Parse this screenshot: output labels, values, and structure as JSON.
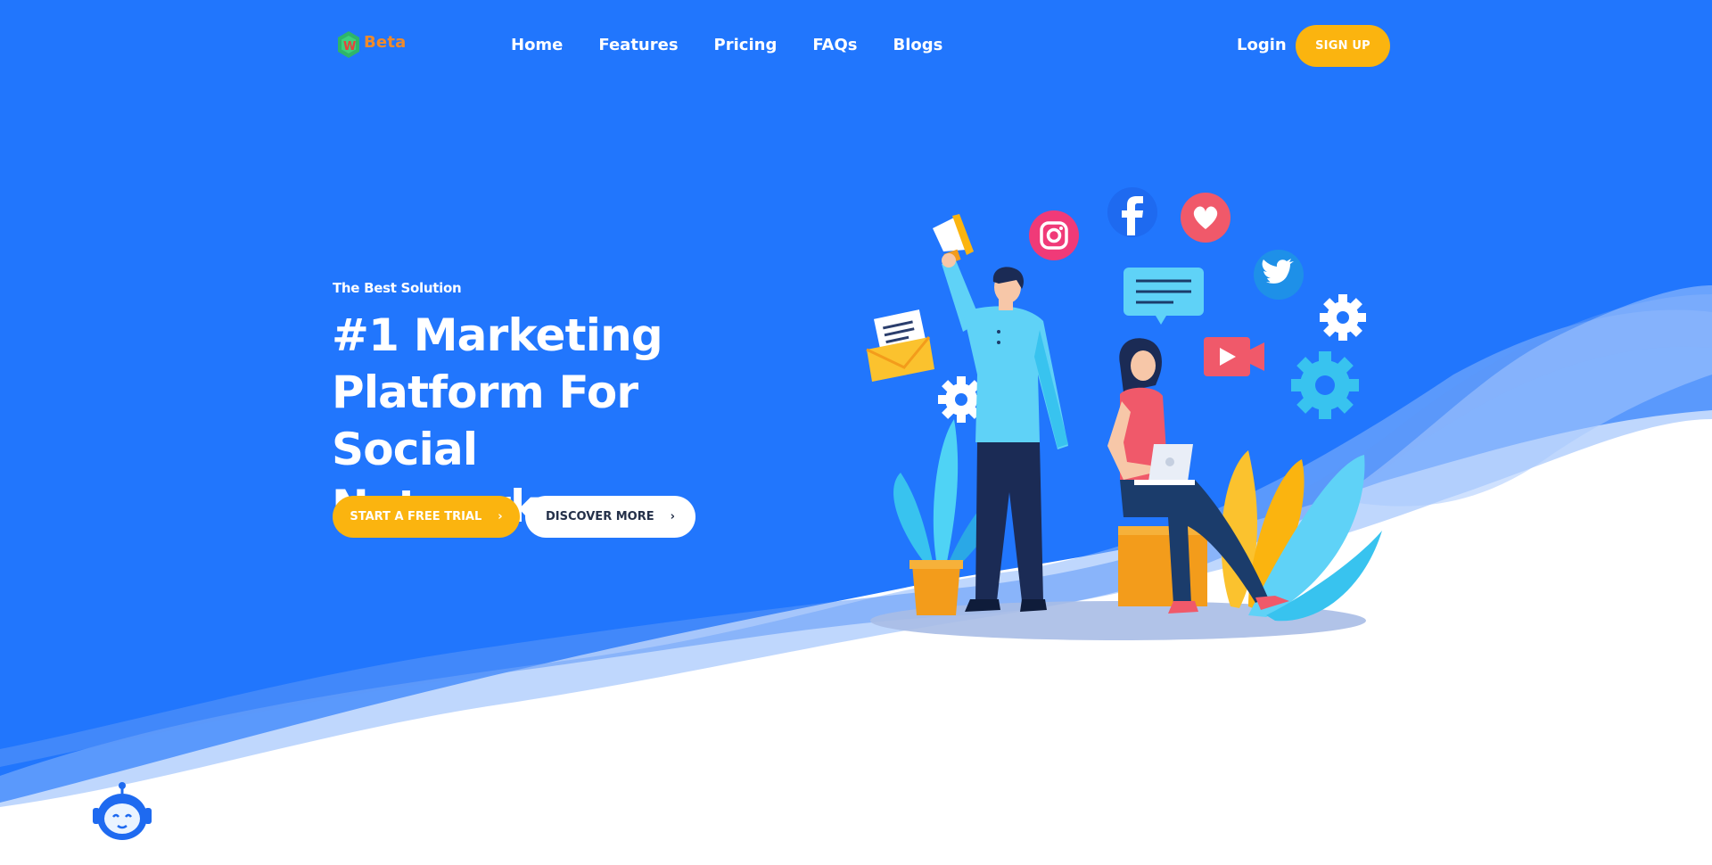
{
  "header": {
    "logo_text": "Beta",
    "logo_badge": "W",
    "nav": [
      {
        "label": "Home"
      },
      {
        "label": "Features"
      },
      {
        "label": "Pricing"
      },
      {
        "label": "FAQs"
      },
      {
        "label": "Blogs"
      }
    ],
    "login_label": "Login",
    "signup_label": "SIGN UP"
  },
  "hero": {
    "eyebrow": "The Best Solution",
    "headline_line1": "#1 Marketing",
    "headline_line2": "Platform For Social",
    "headline_line3": "Network",
    "cta_primary": "START A FREE TRIAL",
    "cta_secondary": "DISCOVER MORE"
  },
  "illustration": {
    "icons": [
      "megaphone-icon",
      "instagram-icon",
      "facebook-icon",
      "heart-icon",
      "twitter-icon",
      "chat-bubble-icon",
      "youtube-icon",
      "gear-icon",
      "envelope-icon"
    ]
  },
  "colors": {
    "brand_blue": "#2176fd",
    "accent_yellow": "#fbb40f",
    "white": "#ffffff"
  }
}
